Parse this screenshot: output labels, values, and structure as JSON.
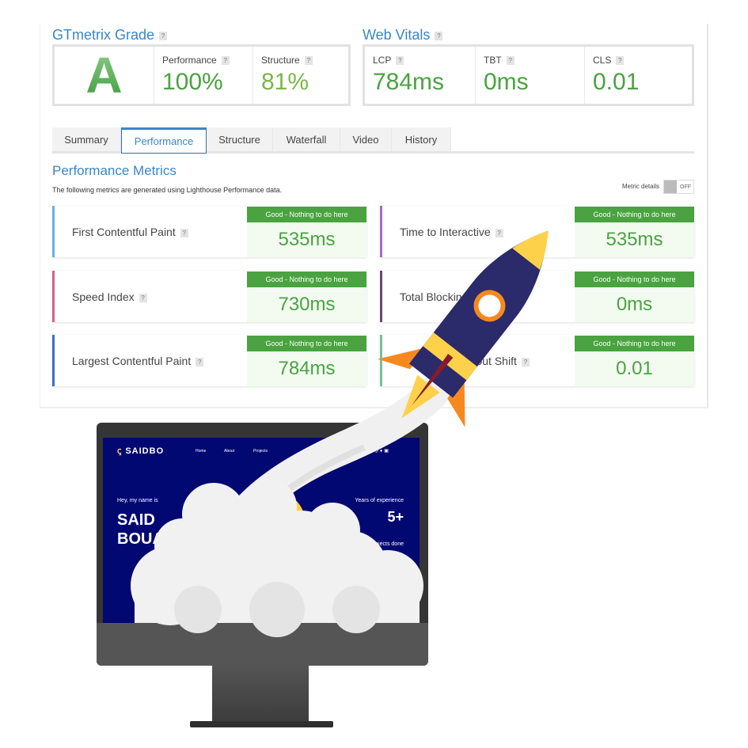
{
  "grade": {
    "title": "GTmetrix Grade",
    "letter": "A",
    "performance_label": "Performance",
    "performance": "100%",
    "structure_label": "Structure",
    "structure": "81%"
  },
  "vitals": {
    "title": "Web Vitals",
    "lcp_label": "LCP",
    "lcp": "784ms",
    "tbt_label": "TBT",
    "tbt": "0ms",
    "cls_label": "CLS",
    "cls": "0.01"
  },
  "help": "?",
  "tabs": [
    "Summary",
    "Performance",
    "Structure",
    "Waterfall",
    "Video",
    "History"
  ],
  "active_tab": "Performance",
  "metrics": {
    "title": "Performance Metrics",
    "subtitle": "The following metrics are generated using Lighthouse Performance data.",
    "details_label": "Metric details",
    "toggle": "OFF",
    "items": [
      {
        "name": "First Contentful Paint",
        "status": "Good - Nothing to do here",
        "value": "535ms",
        "color": "#6ab0de"
      },
      {
        "name": "Time to Interactive",
        "status": "Good - Nothing to do here",
        "value": "535ms",
        "color": "#a070c0"
      },
      {
        "name": "Speed Index",
        "status": "Good - Nothing to do here",
        "value": "730ms",
        "color": "#d0658f"
      },
      {
        "name": "Total Blocking Time",
        "status": "Good - Nothing to do here",
        "value": "0ms",
        "color": "#6a4a70"
      },
      {
        "name": "Largest Contentful Paint",
        "status": "Good - Nothing to do here",
        "value": "784ms",
        "color": "#3a6fc4"
      },
      {
        "name": "Cumulative Layout Shift",
        "status": "Good - Nothing to do here",
        "value": "0.01",
        "color": "#7abf9a"
      }
    ]
  },
  "site": {
    "logo": "SAIDBO",
    "nav": [
      "Home",
      "About",
      "Projects"
    ],
    "greeting": "Hey, my name is",
    "name1": "SAID",
    "name2": "BOUA",
    "years_label": "Years of experience",
    "years": "5+",
    "projects_label": "Projects done"
  },
  "colors": {
    "accent": "#3a86c8",
    "good": "#4aa340",
    "site_bg": "#020872",
    "rocket_body": "#2b2a6b",
    "rocket_yellow": "#fdd14a",
    "flame": "#f5891f"
  }
}
